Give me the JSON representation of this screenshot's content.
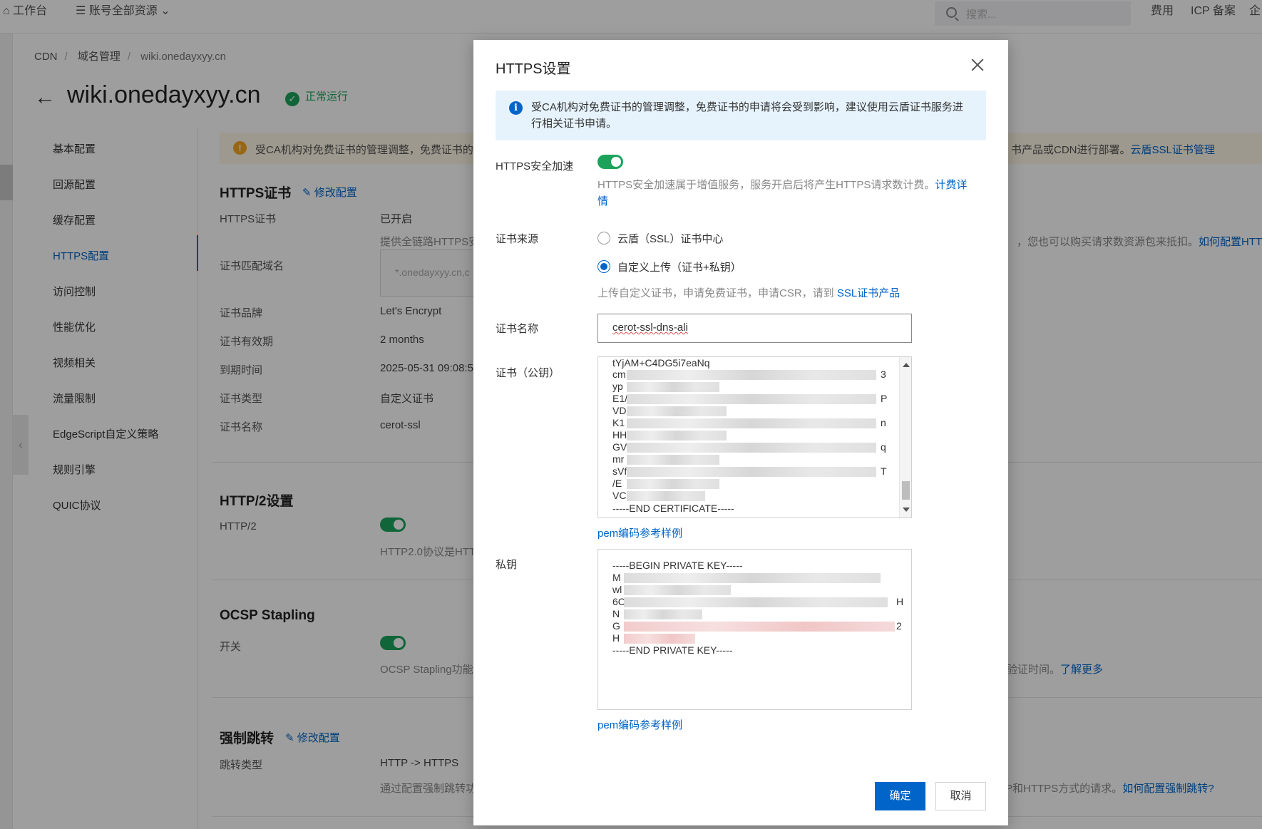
{
  "topbar": {
    "workbench": "工作台",
    "resources": "账号全部资源",
    "search_placeholder": "搜索...",
    "fees": "费用",
    "icp": "ICP 备案",
    "enterprise": "企"
  },
  "breadcrumb": [
    "CDN",
    "域名管理",
    "wiki.onedayxyy.cn"
  ],
  "page": {
    "title": "wiki.onedayxyy.cn",
    "status": "正常运行"
  },
  "sidenav": {
    "items": [
      "基本配置",
      "回源配置",
      "缓存配置",
      "HTTPS配置",
      "访问控制",
      "性能优化",
      "视频相关",
      "流量限制",
      "EdgeScript自定义策略",
      "规则引擎",
      "QUIC协议"
    ],
    "active": "HTTPS配置"
  },
  "warning": {
    "text_left": "受CA机构对免费证书的管理调整，免费证书的",
    "text_right": "书产品或CDN进行部署。",
    "link": "云盾SSL证书管理"
  },
  "https_cert": {
    "title": "HTTPS证书",
    "edit": "修改配置",
    "rows": [
      {
        "label": "HTTPS证书",
        "value": "已开启"
      },
      {
        "label": "证书匹配域名",
        "value": ""
      },
      {
        "label": "证书品牌",
        "value": "Let's Encrypt"
      },
      {
        "label": "证书有效期",
        "value": "2 months"
      },
      {
        "label": "到期时间",
        "value": "2025-05-31 09:08:5"
      },
      {
        "label": "证书类型",
        "value": "自定义证书"
      },
      {
        "label": "证书名称",
        "value": "cerot-ssl"
      }
    ],
    "hint_left": "提供全链路HTTPS安",
    "hint_right": "，您也可以购买请求数资源包来抵扣。",
    "hint_link": "如何配置HTTPS",
    "domain_placeholder": "*.onedayxyy.cn,c"
  },
  "http2": {
    "title": "HTTP/2设置",
    "label": "HTTP/2",
    "hint": "HTTP2.0协议是HTT"
  },
  "ocsp": {
    "title": "OCSP Stapling",
    "label": "开关",
    "hint_left": "OCSP Stapling功能可",
    "hint_right": "验证时间。",
    "hint_link": "了解更多"
  },
  "redirect": {
    "title": "强制跳转",
    "edit": "修改配置",
    "label": "跳转类型",
    "value": "HTTP -> HTTPS",
    "hint_left": "通过配置强制跳转功",
    "hint_right": "P和HTTPS方式的请求。",
    "hint_link": "如何配置强制跳转?"
  },
  "modal": {
    "title": "HTTPS设置",
    "info": "受CA机构对免费证书的管理调整，免费证书的申请将会受到影响，建议使用云盾证书服务进行相关证书申请。",
    "https_accel_label": "HTTPS安全加速",
    "https_accel_on": true,
    "https_accel_desc": "HTTPS安全加速属于增值服务，服务开启后将产生HTTPS请求数计费。",
    "https_accel_link": "计费详情",
    "cert_source_label": "证书来源",
    "cert_source_options": [
      "云盾（SSL）证书中心",
      "自定义上传（证书+私钥）"
    ],
    "cert_source_selected": "自定义上传（证书+私钥）",
    "cert_source_desc": "上传自定义证书，申请免费证书，申请CSR，请到",
    "cert_source_link": "SSL证书产品",
    "cert_name_label": "证书名称",
    "cert_name_value": "cerot-ssl-dns-ali",
    "cert_pub_label": "证书（公钥）",
    "cert_pub_lines": [
      "tYjAM+C4DG5i7eaNq",
      "cm",
      "yp",
      "E1/",
      "VD",
      "K1",
      "HH",
      "GV",
      "mr",
      "sVf",
      "/E",
      "VC",
      "-----END CERTIFICATE-----"
    ],
    "cert_pub_tails": [
      "",
      "3",
      "",
      "P",
      "",
      "n",
      "",
      "q",
      "",
      "T",
      "",
      "",
      ""
    ],
    "pem_link": "pem编码参考样例",
    "private_key_label": "私钥",
    "private_key_lines": [
      "-----BEGIN PRIVATE KEY-----",
      "M",
      "wl",
      "6C",
      "N",
      "G",
      "H",
      "-----END PRIVATE KEY-----"
    ],
    "private_key_tails": [
      "",
      "",
      "",
      "H",
      "",
      "2",
      "",
      ""
    ],
    "pem_link2": "pem编码参考样例",
    "ok": "确定",
    "cancel": "取消"
  }
}
